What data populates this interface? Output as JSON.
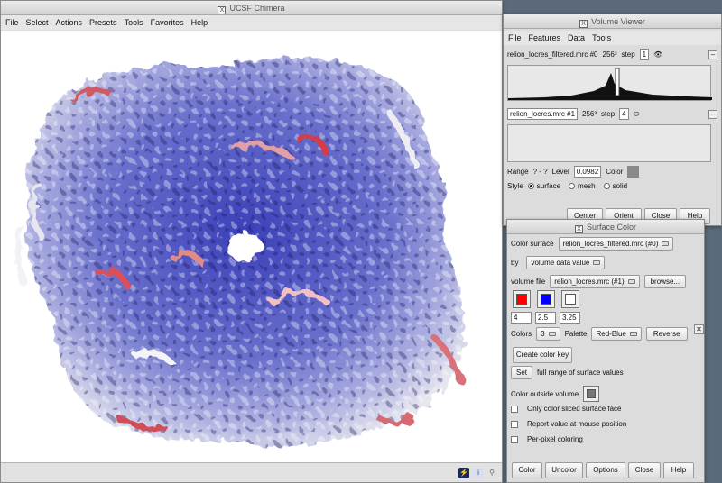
{
  "chimera": {
    "title": "UCSF Chimera",
    "menu": [
      "File",
      "Select",
      "Actions",
      "Presets",
      "Tools",
      "Favorites",
      "Help"
    ]
  },
  "volume_viewer": {
    "title": "Volume Viewer",
    "menu": [
      "File",
      "Features",
      "Data",
      "Tools"
    ],
    "map0": {
      "name": "relion_locres_filtered.mrc #0",
      "size": "256³",
      "step_label": "step",
      "step": "1",
      "eye": "👁"
    },
    "map1": {
      "name": "relion_locres.mrc #1",
      "size": "256³",
      "step_label": "step",
      "step": "4",
      "eye": "⬭"
    },
    "range_label": "Range",
    "range_value": "? - ?",
    "level_label": "Level",
    "level_value": "0.0982",
    "color_label": "Color",
    "style_label": "Style",
    "styles": [
      "surface",
      "mesh",
      "solid"
    ],
    "buttons": [
      "Center",
      "Orient",
      "Close",
      "Help"
    ]
  },
  "surface_color": {
    "title": "Surface Color",
    "color_surface_label": "Color surface",
    "color_surface_value": "relion_locres_filtered.mrc (#0)",
    "by_label": "by",
    "by_value": "volume data value",
    "volume_file_label": "volume file",
    "volume_file_value": "relion_locres.mrc (#1)",
    "browse_label": "browse...",
    "swatches": [
      "#ff0000",
      "#0000ff",
      "#ffffff"
    ],
    "thresholds": [
      "4",
      "2.5",
      "3.25"
    ],
    "colors_label": "Colors",
    "colors_value": "3",
    "palette_label": "Palette",
    "palette_value": "Red-Blue",
    "reverse_label": "Reverse",
    "create_key_label": "Create color key",
    "set_label": "Set",
    "set_desc": "full range of surface values",
    "outside_label": "Color outside volume",
    "outside_color": "#777777",
    "checks": [
      "Only color sliced surface face",
      "Report value at mouse position",
      "Per-pixel coloring"
    ],
    "buttons": [
      "Color",
      "Uncolor",
      "Options",
      "Close",
      "Help"
    ],
    "close_x": "✕"
  },
  "colors": {
    "surface_blue": "#5b63c8",
    "surface_white": "#f2f2f2",
    "surface_red": "#d9505a"
  }
}
